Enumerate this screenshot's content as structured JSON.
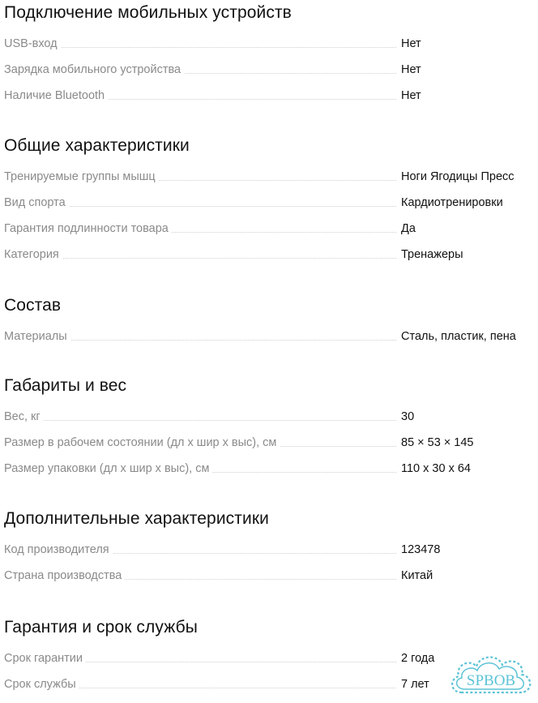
{
  "sections": [
    {
      "title": "Подключение мобильных устройств",
      "rows": [
        {
          "label": "USB-вход",
          "value": "Нет"
        },
        {
          "label": "Зарядка мобильного устройства",
          "value": "Нет"
        },
        {
          "label": "Наличие Bluetooth",
          "value": "Нет"
        }
      ]
    },
    {
      "title": "Общие характеристики",
      "rows": [
        {
          "label": "Тренируемые группы мышц",
          "value": "Ноги Ягодицы Пресс"
        },
        {
          "label": "Вид спорта",
          "value": "Кардиотренировки"
        },
        {
          "label": "Гарантия подлинности товара",
          "value": "Да"
        },
        {
          "label": "Категория",
          "value": "Тренажеры"
        }
      ]
    },
    {
      "title": "Состав",
      "rows": [
        {
          "label": "Материалы",
          "value": "Сталь, пластик, пена"
        }
      ]
    },
    {
      "title": "Габариты и вес",
      "rows": [
        {
          "label": "Вес, кг",
          "value": "30"
        },
        {
          "label": "Размер в рабочем состоянии (дл х шир х выс), см",
          "value": "85 × 53 × 145"
        },
        {
          "label": "Размер упаковки (дл х шир х выс), см",
          "value": "110 x 30 x 64"
        }
      ]
    },
    {
      "title": "Дополнительные характеристики",
      "rows": [
        {
          "label": "Код производителя",
          "value": "123478"
        },
        {
          "label": "Страна производства",
          "value": "Китай"
        }
      ]
    },
    {
      "title": "Гарантия и срок службы",
      "rows": [
        {
          "label": "Срок гарантии",
          "value": "2 года"
        },
        {
          "label": "Срок службы",
          "value": "7 лет"
        }
      ]
    }
  ],
  "watermark": {
    "text": "SPBOB",
    "color": "#5cc3d6",
    "icon": "cloud-logo-icon"
  },
  "colors": {
    "title": "#111111",
    "label": "#8a8a8a",
    "value": "#111111",
    "dots": "#cfcfcf"
  }
}
